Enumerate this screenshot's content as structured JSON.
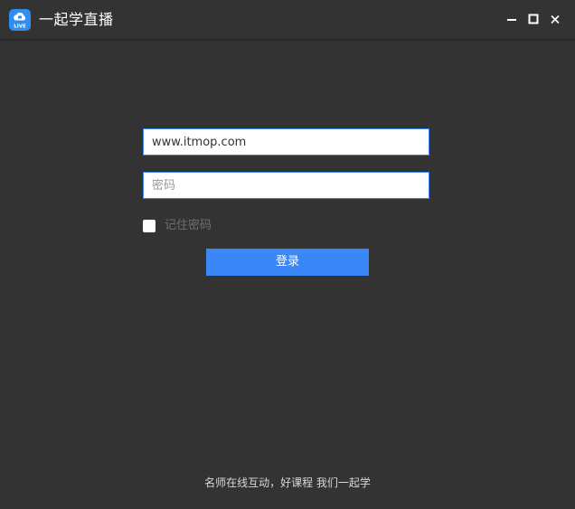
{
  "window": {
    "title": "一起学直播",
    "app_icon_text": "LIVE"
  },
  "login": {
    "account_value": "www.itmop.com",
    "password_placeholder": "密码",
    "remember_label": "记住密码",
    "remember_checked": false,
    "submit_label": "登录"
  },
  "footer": {
    "slogan": "名师在线互动，好课程 我们一起学"
  },
  "icons": {
    "app": "cloud-live-icon",
    "minimize": "minimize-icon",
    "maximize": "maximize-icon",
    "close": "close-icon"
  },
  "colors": {
    "background": "#333333",
    "accent": "#3c87f7",
    "field_border": "#3f83f0",
    "app_icon": "#2f8ef0"
  }
}
